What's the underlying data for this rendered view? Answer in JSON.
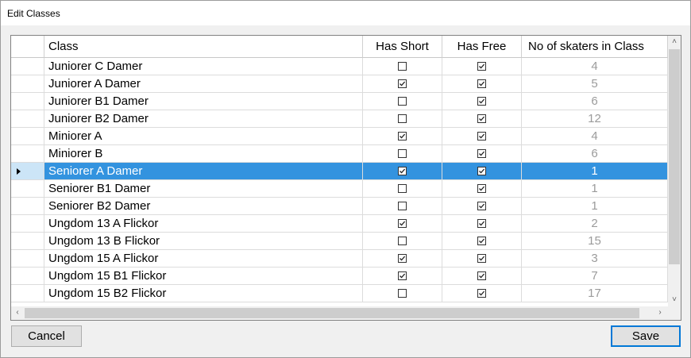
{
  "window": {
    "title": "Edit Classes"
  },
  "grid": {
    "columns": {
      "class": "Class",
      "has_short": "Has Short",
      "has_free": "Has Free",
      "count": "No of skaters in Class"
    },
    "rows": [
      {
        "class": "Juniorer C Damer",
        "has_short": false,
        "has_free": true,
        "count": "4"
      },
      {
        "class": "Juniorer A Damer",
        "has_short": true,
        "has_free": true,
        "count": "5"
      },
      {
        "class": "Juniorer B1 Damer",
        "has_short": false,
        "has_free": true,
        "count": "6"
      },
      {
        "class": "Juniorer B2 Damer",
        "has_short": false,
        "has_free": true,
        "count": "12"
      },
      {
        "class": "Miniorer A",
        "has_short": true,
        "has_free": true,
        "count": "4"
      },
      {
        "class": "Miniorer B",
        "has_short": false,
        "has_free": true,
        "count": "6"
      },
      {
        "class": "Seniorer A Damer",
        "has_short": true,
        "has_free": true,
        "count": "1",
        "selected": true
      },
      {
        "class": "Seniorer B1 Damer",
        "has_short": false,
        "has_free": true,
        "count": "1"
      },
      {
        "class": "Seniorer B2 Damer",
        "has_short": false,
        "has_free": true,
        "count": "1"
      },
      {
        "class": "Ungdom 13 A Flickor",
        "has_short": true,
        "has_free": true,
        "count": "2"
      },
      {
        "class": "Ungdom 13 B Flickor",
        "has_short": false,
        "has_free": true,
        "count": "15"
      },
      {
        "class": "Ungdom 15 A Flickor",
        "has_short": true,
        "has_free": true,
        "count": "3"
      },
      {
        "class": "Ungdom 15 B1 Flickor",
        "has_short": true,
        "has_free": true,
        "count": "7"
      },
      {
        "class": "Ungdom 15 B2 Flickor",
        "has_short": false,
        "has_free": true,
        "count": "17"
      }
    ]
  },
  "buttons": {
    "cancel": "Cancel",
    "save": "Save"
  },
  "icons": {
    "scroll_up": "chevron-up-icon",
    "scroll_down": "chevron-down-icon",
    "scroll_left": "chevron-left-icon",
    "scroll_right": "chevron-right-icon",
    "row_pointer": "row-pointer-icon"
  },
  "colors": {
    "selection": "#3393df",
    "selector_selected": "#cce5f7",
    "count_text": "#9b9b9b",
    "save_border": "#0078d7"
  }
}
